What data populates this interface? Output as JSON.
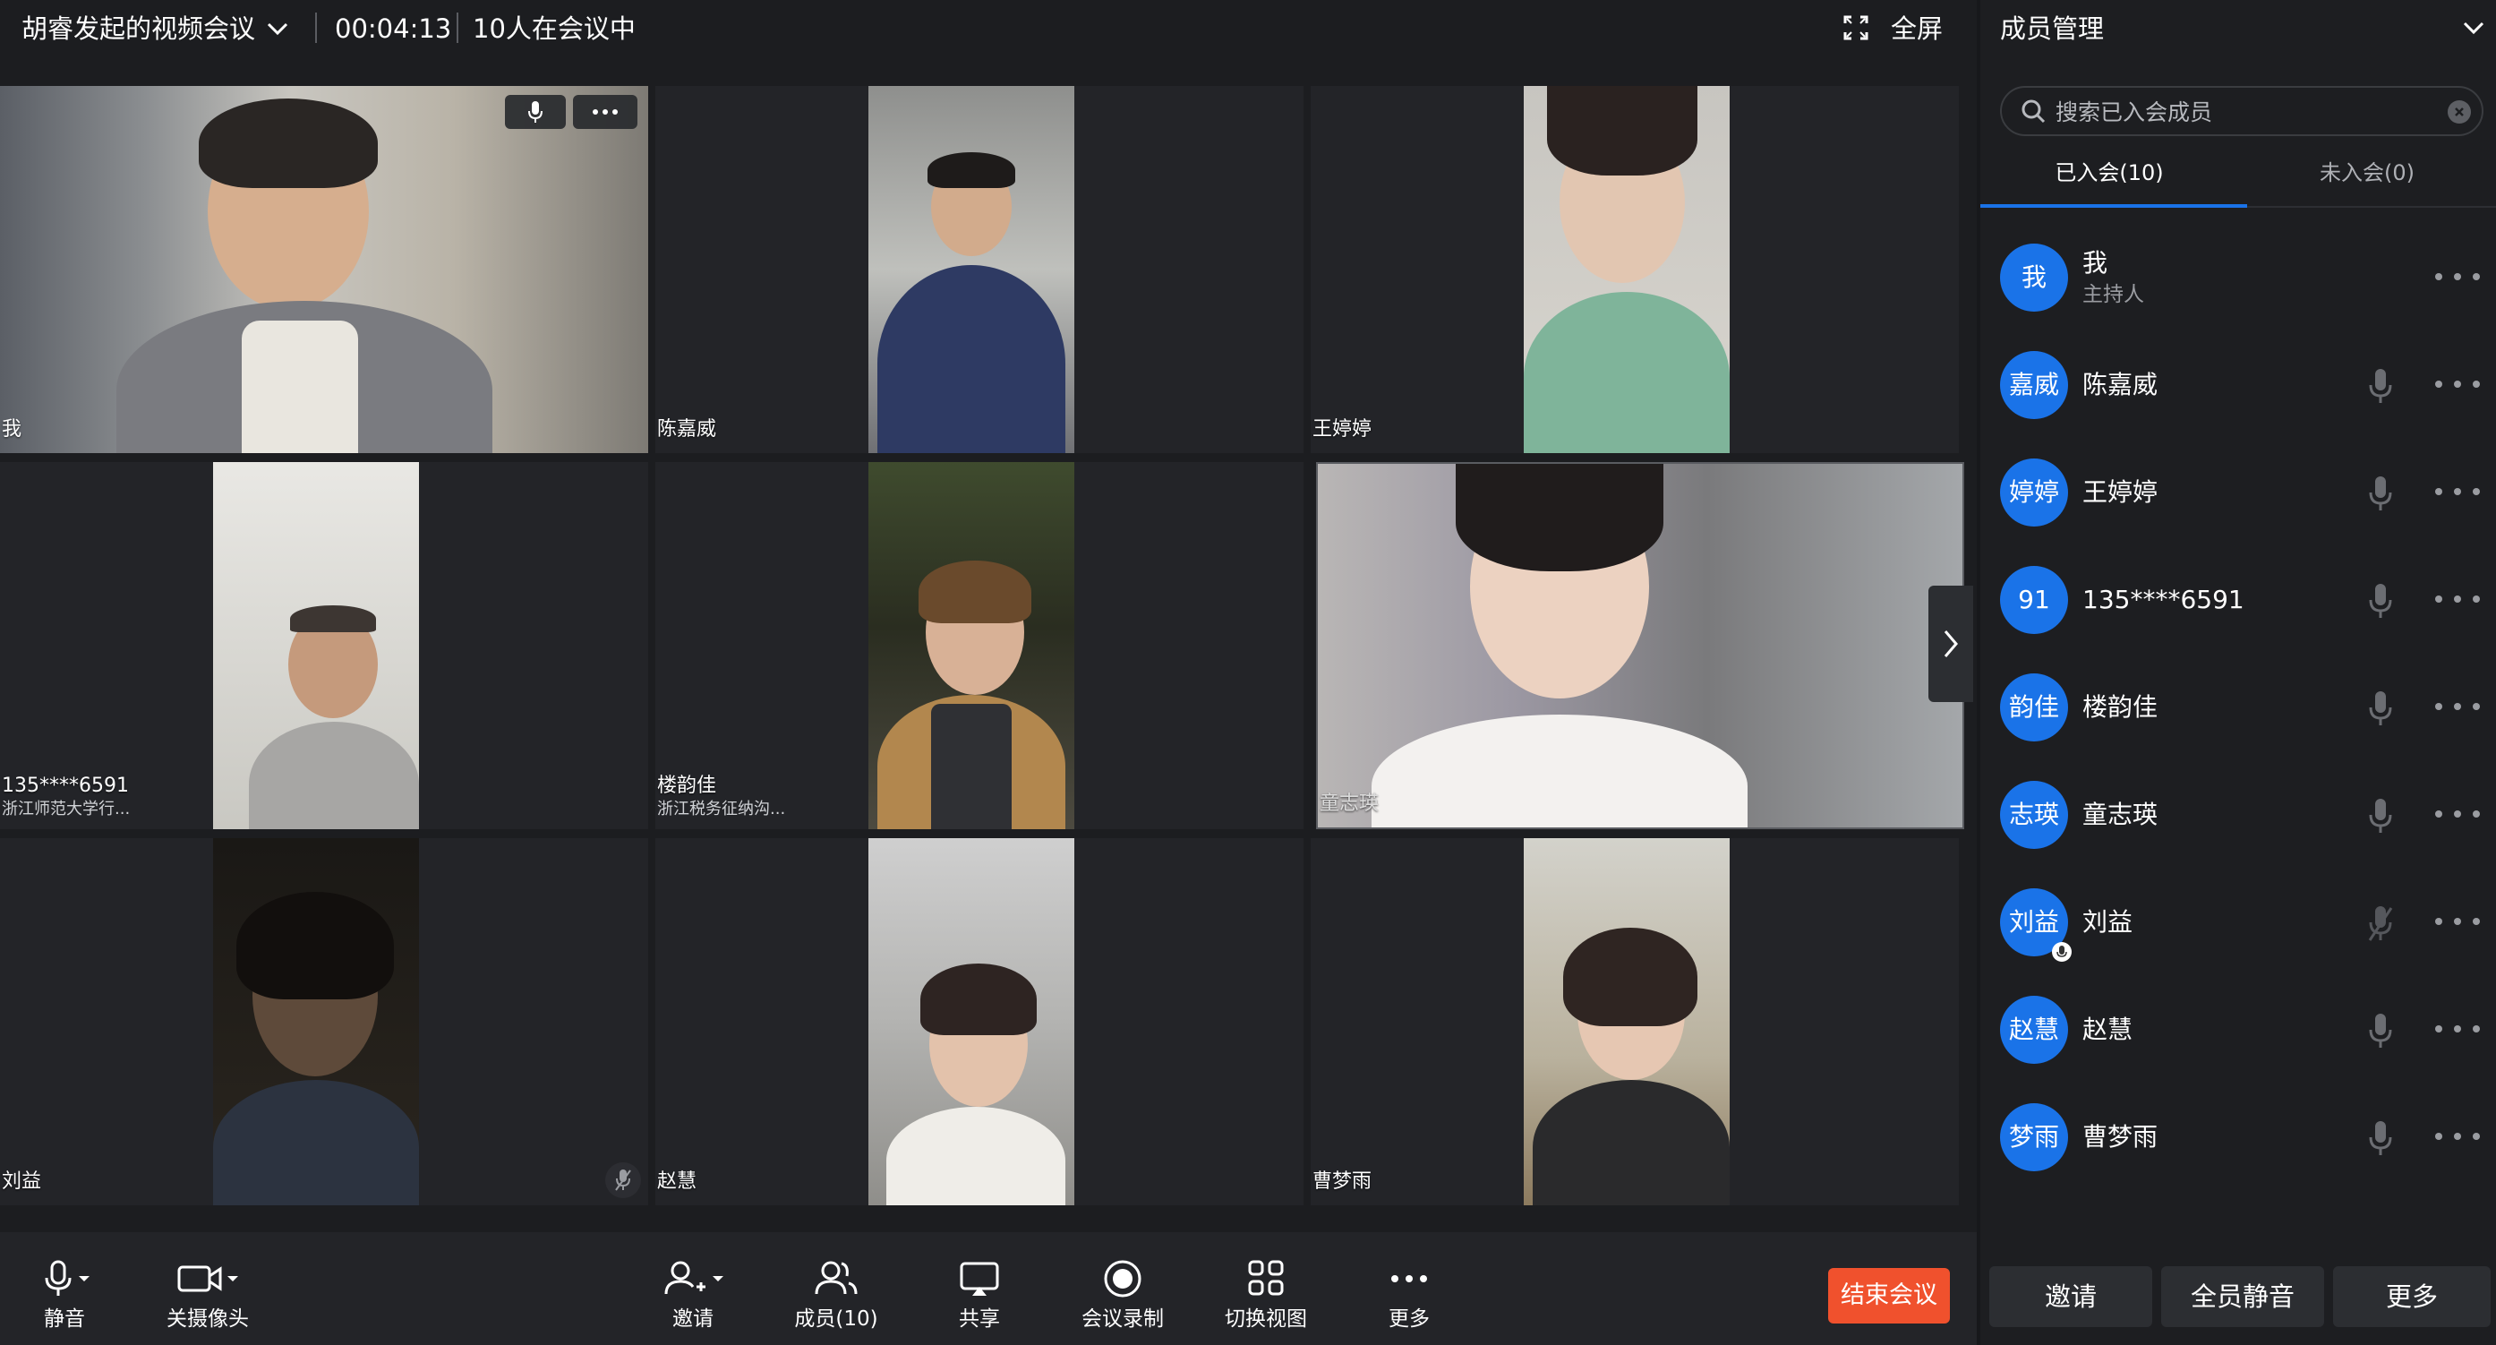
{
  "header": {
    "meeting_title": "胡睿发起的视频会议",
    "timer": "00:04:13",
    "participants_status": "10人在会议中",
    "fullscreen_label": "全屏"
  },
  "tiles": [
    {
      "name": "我",
      "sub": ""
    },
    {
      "name": "陈嘉威",
      "sub": ""
    },
    {
      "name": "王婷婷",
      "sub": ""
    },
    {
      "name": "135****6591",
      "sub": "浙江师范大学行..."
    },
    {
      "name": "楼韵佳",
      "sub": "浙江税务征纳沟..."
    },
    {
      "name": "童志瑛",
      "sub": ""
    },
    {
      "name": "刘益",
      "sub": ""
    },
    {
      "name": "赵慧",
      "sub": ""
    },
    {
      "name": "曹梦雨",
      "sub": ""
    }
  ],
  "toolbar": {
    "mute_label": "静音",
    "camera_label": "关摄像头",
    "invite_label": "邀请",
    "members_label": "成员(10)",
    "share_label": "共享",
    "record_label": "会议录制",
    "switch_view_label": "切换视图",
    "more_label": "更多",
    "end_meeting_label": "结束会议"
  },
  "panel": {
    "title": "成员管理",
    "search_placeholder": "搜索已入会成员",
    "tab_joined": "已入会(10)",
    "tab_not_joined": "未入会(0)",
    "members": [
      {
        "avatar": "我",
        "name": "我",
        "role": "主持人",
        "mic": "none"
      },
      {
        "avatar": "嘉威",
        "name": "陈嘉威",
        "role": "",
        "mic": "on"
      },
      {
        "avatar": "婷婷",
        "name": "王婷婷",
        "role": "",
        "mic": "on"
      },
      {
        "avatar": "91",
        "name": "135****6591",
        "role": "",
        "mic": "on"
      },
      {
        "avatar": "韵佳",
        "name": "楼韵佳",
        "role": "",
        "mic": "on"
      },
      {
        "avatar": "志瑛",
        "name": "童志瑛",
        "role": "",
        "mic": "on"
      },
      {
        "avatar": "刘益",
        "name": "刘益",
        "role": "",
        "mic": "off"
      },
      {
        "avatar": "赵慧",
        "name": "赵慧",
        "role": "",
        "mic": "on"
      },
      {
        "avatar": "梦雨",
        "name": "曹梦雨",
        "role": "",
        "mic": "on"
      }
    ],
    "invite_button": "邀请",
    "mute_all_button": "全员静音",
    "more_button": "更多"
  },
  "colors": {
    "accent": "#1a73e8",
    "end_button": "#f0512d",
    "background": "#1c1d20"
  }
}
